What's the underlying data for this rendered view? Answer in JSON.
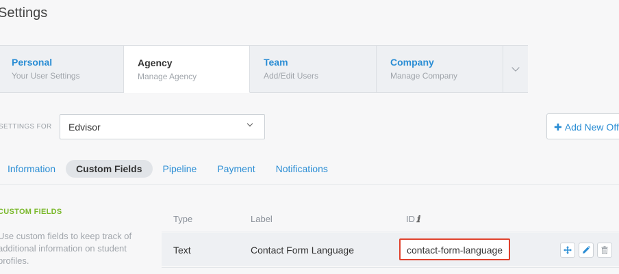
{
  "page": {
    "title": "Settings"
  },
  "tabs": [
    {
      "title": "Personal",
      "subtitle": "Your User Settings"
    },
    {
      "title": "Agency",
      "subtitle": "Manage Agency"
    },
    {
      "title": "Team",
      "subtitle": "Add/Edit Users"
    },
    {
      "title": "Company",
      "subtitle": "Manage Company"
    }
  ],
  "settings_for": {
    "label": "SETTINGS FOR",
    "selected": "Edvisor"
  },
  "add_button": {
    "label": "Add New Off"
  },
  "subtabs": [
    {
      "label": "Information"
    },
    {
      "label": "Custom Fields"
    },
    {
      "label": "Pipeline"
    },
    {
      "label": "Payment"
    },
    {
      "label": "Notifications"
    }
  ],
  "custom_fields": {
    "heading": "CUSTOM FIELDS",
    "description": "Use custom fields to keep track of additional information on student profiles."
  },
  "table": {
    "columns": {
      "type": "Type",
      "label": "Label",
      "id": "ID"
    },
    "rows": [
      {
        "type": "Text",
        "label": "Contact Form Language",
        "id": "contact-form-language"
      }
    ]
  },
  "colors": {
    "accent": "#2a8dd4",
    "green": "#7ab82b",
    "highlight": "#e0412c"
  },
  "icons": [
    "chevron-down-icon",
    "plus-icon",
    "info-icon",
    "move-icon",
    "edit-icon",
    "trash-icon"
  ]
}
